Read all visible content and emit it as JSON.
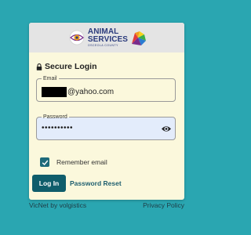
{
  "logo": {
    "line1": "ANIMAL",
    "line2": "SERVICES",
    "line3": "OSCEOLA COUNTY"
  },
  "title": "Secure Login",
  "email": {
    "label": "Email",
    "value_visible": "@yahoo.com"
  },
  "password": {
    "label": "Password",
    "value": "••••••••••"
  },
  "remember": {
    "label": "Remember email",
    "checked": true
  },
  "login_button": "Log In",
  "password_reset": "Password Reset",
  "footer": {
    "brand": "VicNet by volgistics",
    "privacy": "Privacy Policy"
  },
  "colors": {
    "background": "#2aa6b1",
    "card": "#fbf8dc",
    "primary": "#0f5d6b"
  }
}
